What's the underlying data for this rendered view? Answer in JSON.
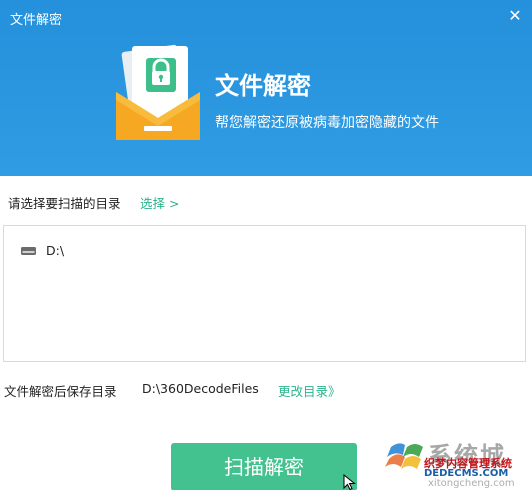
{
  "window": {
    "title": "文件解密",
    "close_glyph": "✕"
  },
  "hero": {
    "icon": "locked-envelope-icon",
    "title": "文件解密",
    "subtitle": "帮您解密还原被病毒加密隐藏的文件"
  },
  "select": {
    "label": "请选择要扫描的目录",
    "link": "选择 >"
  },
  "dir_list": [
    {
      "icon": "drive-icon",
      "label": "D:\\"
    }
  ],
  "save": {
    "label": "文件解密后保存目录",
    "path": "D:\\360DecodeFiles",
    "change_link": "更改目录》"
  },
  "scan_button": {
    "label": "扫描解密"
  },
  "colors": {
    "header": "#2590db",
    "accent_green": "#2bb38a",
    "button": "#43c28f"
  },
  "watermark": {
    "logo": "windows-logo-icon",
    "brand": "系统城",
    "red_text": "织梦内容管理系统",
    "url": "DEDECMS.COM",
    "url2": "xitongcheng.com"
  }
}
